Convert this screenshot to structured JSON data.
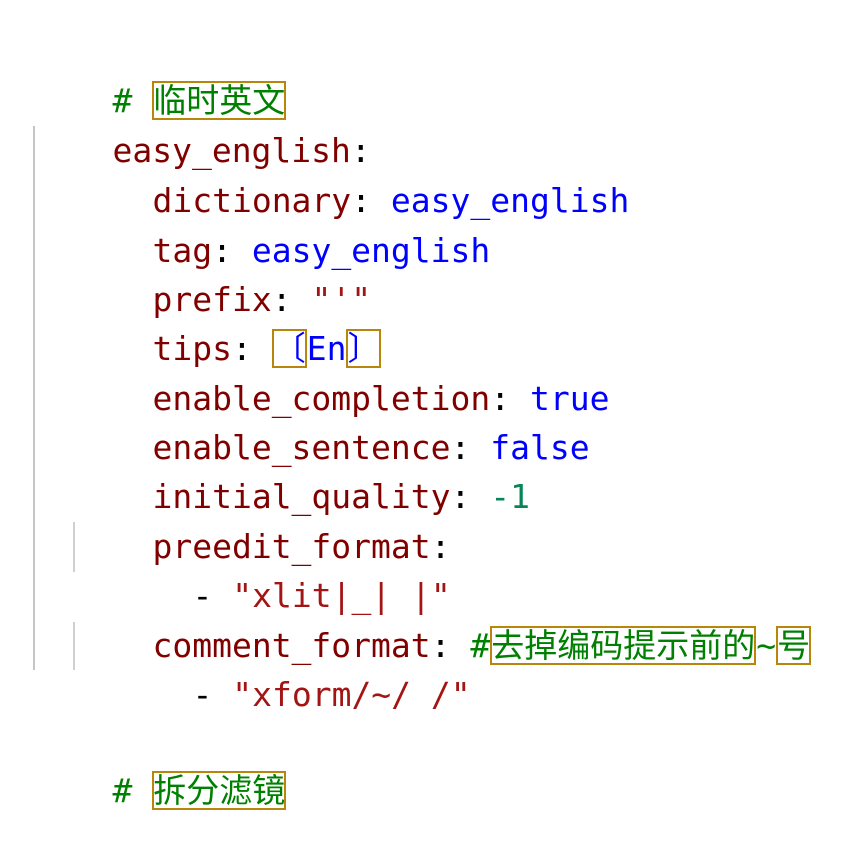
{
  "editor": {
    "language": "yaml",
    "lines": {
      "l1_hash": "# ",
      "l1_comment": "临时英文",
      "l2_key": "easy_english",
      "l2_colon": ":",
      "l3_key": "dictionary",
      "l3_colon": ": ",
      "l3_val": "easy_english",
      "l4_key": "tag",
      "l4_colon": ": ",
      "l4_val": "easy_english",
      "l5_key": "prefix",
      "l5_colon": ": ",
      "l5_val": "\"'\"",
      "l6_key": "tips",
      "l6_colon": ": ",
      "l6_open": "〔",
      "l6_val": "En",
      "l6_close": "〕",
      "l7_key": "enable_completion",
      "l7_colon": ": ",
      "l7_val": "true",
      "l8_key": "enable_sentence",
      "l8_colon": ": ",
      "l8_val": "false",
      "l9_key": "initial_quality",
      "l9_colon": ": ",
      "l9_val": "-1",
      "l10_key": "preedit_format",
      "l10_colon": ":",
      "l11_dash": "- ",
      "l11_val": "\"xlit|_| |\"",
      "l12_key": "comment_format",
      "l12_colon": ": ",
      "l12_hash": "#",
      "l12_comment_a": "去掉编码提示前的",
      "l12_comment_b": "~",
      "l12_comment_c": "号",
      "l13_dash": "- ",
      "l13_val": "\"xform/~/ /\"",
      "l15_hash": "# ",
      "l15_comment": "拆分滤镜"
    }
  },
  "colors": {
    "key": "#800000",
    "keyword_value": "#0000ff",
    "number_value": "#098658",
    "string_value": "#a31515",
    "comment": "#008000",
    "highlight_border": "#b8860b"
  }
}
